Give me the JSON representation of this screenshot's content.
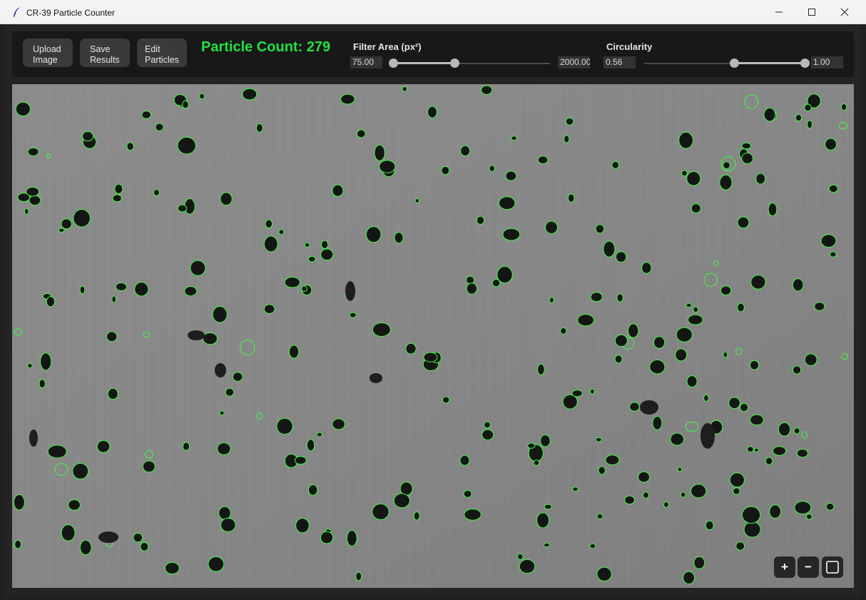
{
  "window": {
    "title": "CR-39 Particle Counter",
    "icon": "feather-icon",
    "controls": [
      "minimize-icon",
      "maximize-icon",
      "close-icon"
    ]
  },
  "toolbar": {
    "upload_label": "Upload\nImage",
    "save_label": "Save\nResults",
    "edit_label": "Edit\nParticles",
    "particle_count": "Particle Count: 279"
  },
  "filter_area": {
    "label": "Filter Area (px²)",
    "min_value": "75.00",
    "max_value": "2000.00",
    "low_fraction": 0.0,
    "high_fraction": 0.39
  },
  "circularity": {
    "label": "Circularity",
    "min_value": "0.56",
    "max_value": "1.00",
    "low_fraction": 0.56,
    "high_fraction": 1.0
  },
  "zoom": {
    "zoom_in": "+",
    "zoom_out": "−",
    "fit_icon": "fit-screen-icon"
  },
  "colors": {
    "accent_green": "#22e040",
    "outline_green": "#3cff3c",
    "background": "#202020",
    "toolbar": "#181818",
    "button": "#3a3a3a"
  }
}
